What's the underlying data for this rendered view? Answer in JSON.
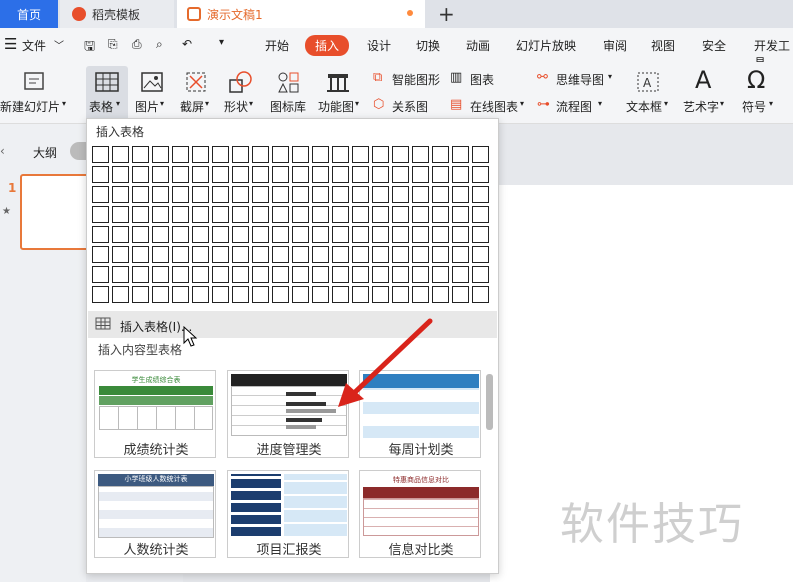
{
  "tabs": {
    "home": "首页",
    "doc1": "稻壳模板",
    "doc2": "演示文稿1"
  },
  "menubar": {
    "file": "文件",
    "items": [
      "开始",
      "插入",
      "设计",
      "切换",
      "动画",
      "幻灯片放映",
      "审阅",
      "视图",
      "安全",
      "开发工具"
    ]
  },
  "ribbon": {
    "new_slide": "新建幻灯片",
    "table": "表格",
    "picture": "图片",
    "screenshot": "截屏",
    "shape": "形状",
    "icon_lib": "图标库",
    "function_chart": "功能图",
    "smart_graphic": "智能图形",
    "chart": "图表",
    "mind_map": "思维导图",
    "relation": "关系图",
    "online_chart": "在线图表",
    "flowchart": "流程图",
    "textbox": "文本框",
    "wordart": "艺术字",
    "symbol": "符号"
  },
  "left_panel": {
    "outline": "大纲",
    "slide_number": "1"
  },
  "dropdown": {
    "title": "插入表格",
    "grid_cols": 20,
    "grid_rows": 8,
    "insert_table": "插入表格(I)...",
    "content_tables_title": "插入内容型表格",
    "templates": [
      {
        "label": "成绩统计类",
        "preview_title": "学生成绩综合表"
      },
      {
        "label": "进度管理类"
      },
      {
        "label": "每周计划类"
      },
      {
        "label": "人数统计类",
        "preview_title": "小学班级人数统计表"
      },
      {
        "label": "项目汇报类"
      },
      {
        "label": "信息对比类",
        "preview_title": "特惠商品信息对比"
      }
    ]
  },
  "watermark": "软件技巧",
  "colors": {
    "accent": "#e84e2b",
    "home_tab": "#2c6fe8",
    "arrow": "#d9241b"
  }
}
